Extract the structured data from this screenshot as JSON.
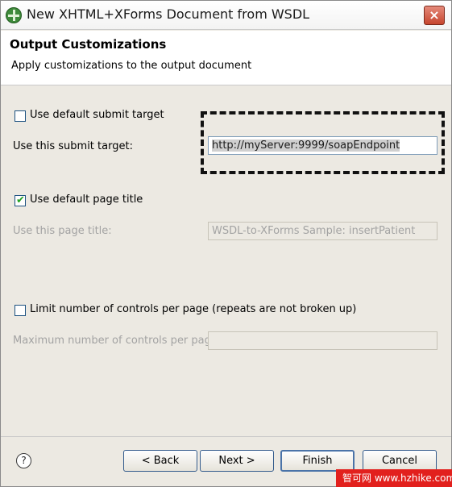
{
  "window": {
    "title": "New XHTML+XForms Document from WSDL",
    "close_label": "×"
  },
  "header": {
    "title": "Output Customizations",
    "description": "Apply customizations to the output document"
  },
  "submit": {
    "default_checkbox_label": "Use default submit target",
    "default_checked": false,
    "target_label": "Use this submit target:",
    "target_value": "http://myServer:9999/soapEndpoint"
  },
  "page_title": {
    "default_checkbox_label": "Use default page title",
    "default_checked": true,
    "title_label": "Use this page title:",
    "title_value": "WSDL-to-XForms Sample: insertPatient"
  },
  "controls": {
    "limit_checkbox_label": "Limit number of controls per page (repeats are not broken up)",
    "limit_checked": false,
    "max_label": "Maximum number of controls per page:",
    "max_value": ""
  },
  "buttons": {
    "help_label": "?",
    "back": "< Back",
    "next": "Next >",
    "finish": "Finish",
    "cancel": "Cancel"
  },
  "watermark": "智可网 www.hzhike.com",
  "colors": {
    "dialog_bg": "#ece9e2",
    "close_button": "#c6452e",
    "checkbox_check": "#21a121",
    "watermark_bg": "#e2201d"
  },
  "icons": {
    "app": "eclipse-plus-icon",
    "close": "close-icon",
    "help": "help-icon",
    "check": "checkmark-icon"
  }
}
